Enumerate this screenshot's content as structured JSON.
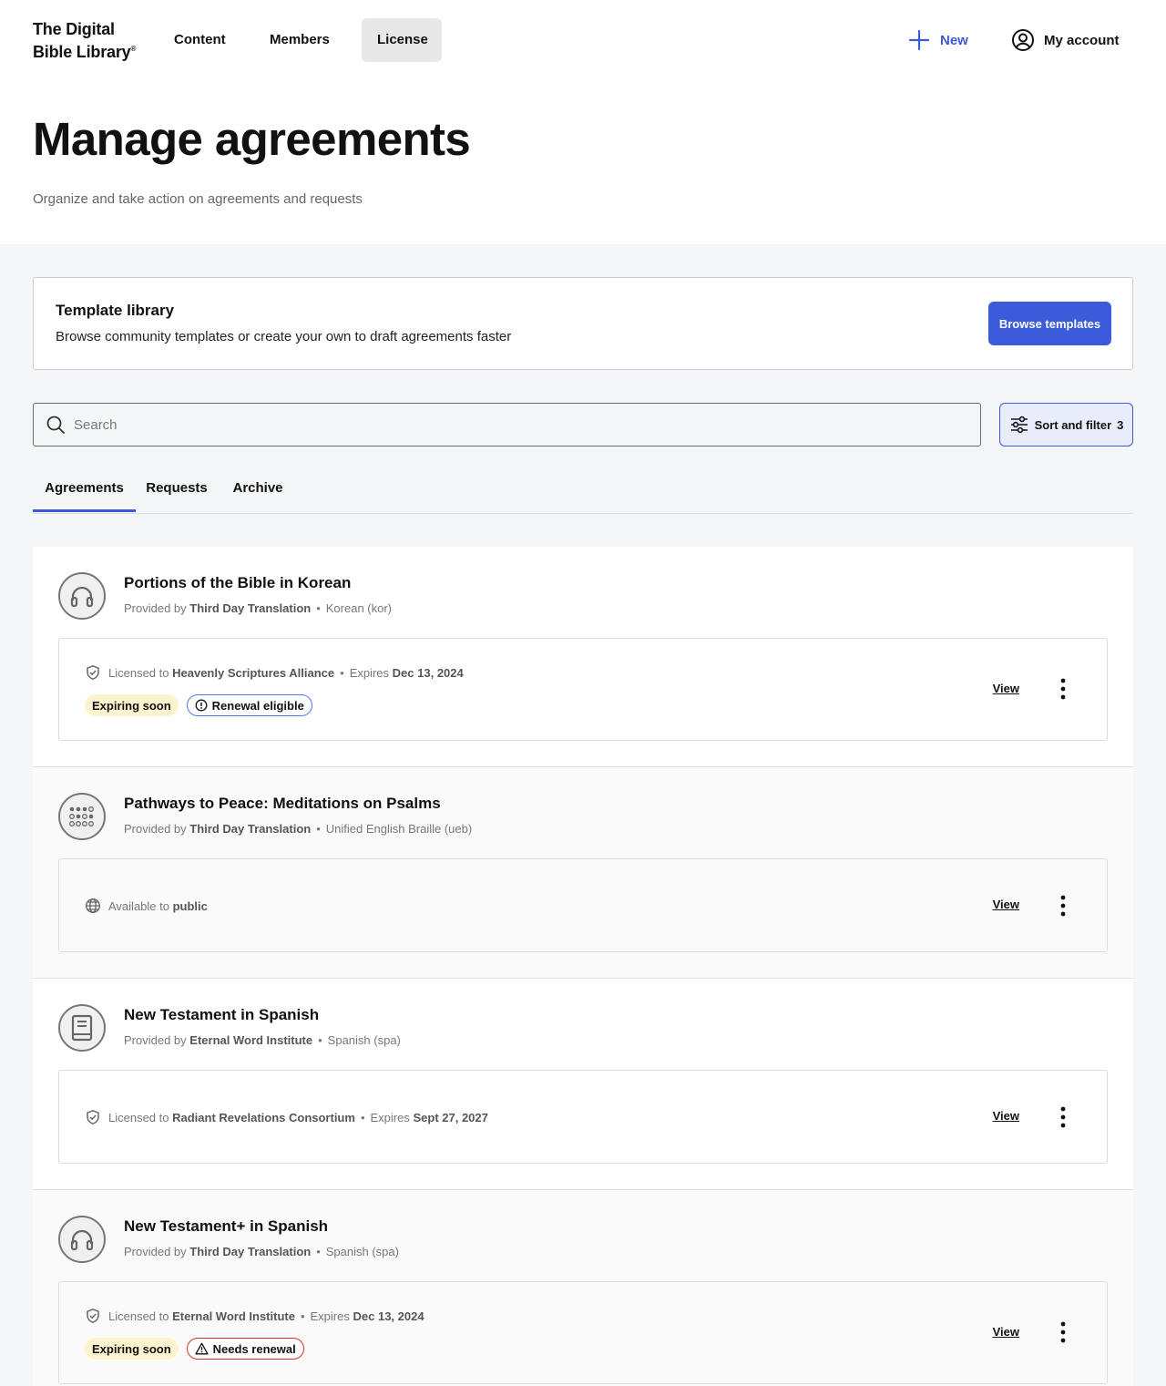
{
  "header": {
    "logo_line1": "The Digital",
    "logo_line2": "Bible Library",
    "logo_mark": "®",
    "nav": [
      {
        "label": "Content",
        "active": false
      },
      {
        "label": "Members",
        "active": false
      },
      {
        "label": "License",
        "active": true
      }
    ],
    "new_label": "New",
    "account_label": "My account"
  },
  "page": {
    "title": "Manage agreements",
    "subtitle": "Organize and take action on agreements and requests"
  },
  "template_library": {
    "title": "Template library",
    "description": "Browse community templates or create your own to draft agreements faster",
    "button_label": "Browse templates"
  },
  "search": {
    "placeholder": "Search",
    "value": ""
  },
  "sort_filter": {
    "label": "Sort and filter",
    "count": "3"
  },
  "tabs": [
    {
      "label": "Agreements",
      "active": true
    },
    {
      "label": "Requests",
      "active": false
    },
    {
      "label": "Archive",
      "active": false
    }
  ],
  "items": [
    {
      "icon": "headphones-icon",
      "title": "Portions of the Bible in Korean",
      "provided_prefix": "Provided by",
      "provider": "Third Day Translation",
      "language": "Korean (kor)",
      "license_prefix": "Licensed to",
      "licensee": "Heavenly Scriptures Alliance",
      "expires_prefix": "Expires",
      "expires": "Dec 13, 2024",
      "badges": [
        {
          "label": "Expiring soon",
          "type": "warn"
        },
        {
          "label": "Renewal eligible",
          "type": "info"
        }
      ],
      "view_label": "View"
    },
    {
      "icon": "braille-icon",
      "title": "Pathways to Peace: Meditations on Psalms",
      "provided_prefix": "Provided by",
      "provider": "Third Day Translation",
      "language": "Unified English Braille (ueb)",
      "availability_prefix": "Available to",
      "availability": "public",
      "view_label": "View"
    },
    {
      "icon": "book-icon",
      "title": "New Testament in Spanish",
      "provided_prefix": "Provided by",
      "provider": "Eternal Word Institute",
      "language": "Spanish (spa)",
      "license_prefix": "Licensed to",
      "licensee": "Radiant Revelations Consortium",
      "expires_prefix": "Expires",
      "expires": "Sept 27, 2027",
      "view_label": "View"
    },
    {
      "icon": "headphones-icon",
      "title": "New Testament+ in Spanish",
      "provided_prefix": "Provided by",
      "provider": "Third Day Translation",
      "language": "Spanish (spa)",
      "license_prefix": "Licensed to",
      "licensee": "Eternal Word Institute",
      "expires_prefix": "Expires",
      "expires": "Dec 13, 2024",
      "badges": [
        {
          "label": "Expiring soon",
          "type": "warn"
        },
        {
          "label": "Needs renewal",
          "type": "danger"
        }
      ],
      "view_label": "View"
    }
  ],
  "colors": {
    "accent": "#3b5bdb",
    "warning_bg": "#fdf4cf",
    "danger": "#d32f2f",
    "info_border": "#5a76e0"
  }
}
